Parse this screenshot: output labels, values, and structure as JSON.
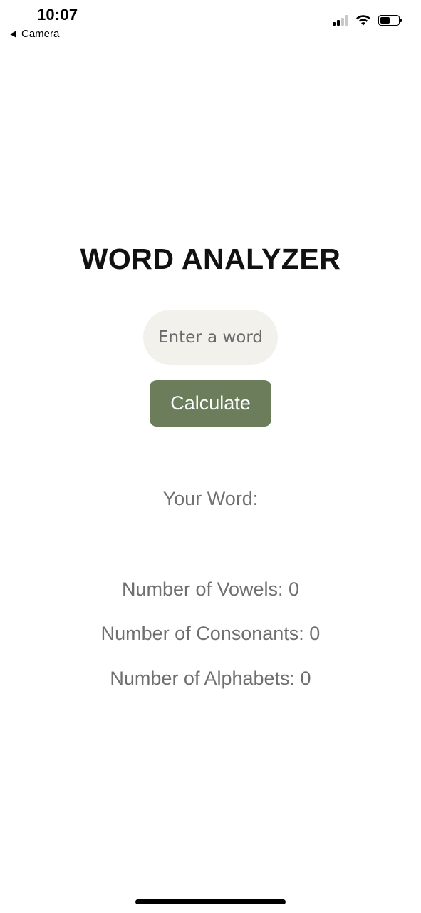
{
  "status_bar": {
    "time": "10:07",
    "back_app": "Camera",
    "battery_level": 0.55,
    "signal_bars": 2,
    "icons": [
      "signal-icon",
      "wifi-icon",
      "battery-icon"
    ]
  },
  "app": {
    "title": "WORD ANALYZER",
    "input": {
      "value": "",
      "placeholder": "Enter a word"
    },
    "calculate_label": "Calculate",
    "results": {
      "your_word": "Your Word:",
      "vowels": "Number of Vowels: 0",
      "consonants": "Number of Consonants: 0",
      "alphabets": "Number of Alphabets: 0"
    }
  },
  "colors": {
    "accent": "#6b7d5b",
    "input_bg": "#f2f1ec",
    "result_text": "#6f6f6f"
  }
}
